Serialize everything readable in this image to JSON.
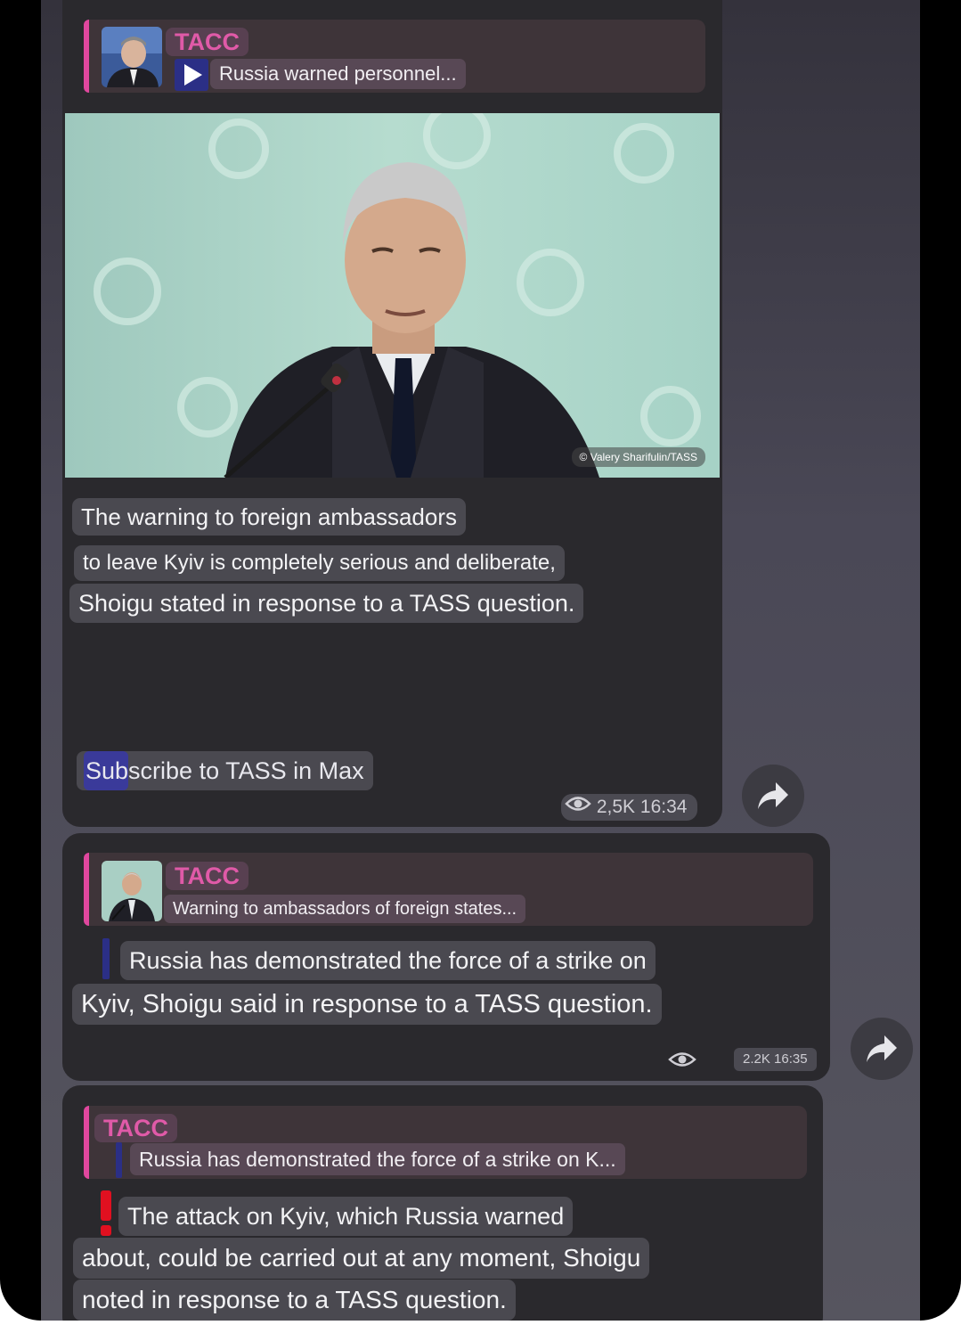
{
  "messages": [
    {
      "reply": {
        "name": "TACC",
        "text": "Russia warned personnel..."
      },
      "photo_credit": "© Valery Sharifulin/TASS",
      "lines": [
        "The warning to foreign ambassadors",
        "to leave Kyiv is completely serious and deliberate,",
        "Shoigu stated in response to a TASS question."
      ],
      "subscribe": "Subscribe to TASS in Max",
      "views": "2,5K",
      "time": "16:34"
    },
    {
      "reply": {
        "name": "TACC",
        "text": "Warning to ambassadors of foreign states..."
      },
      "lines": [
        "Russia has demonstrated the force of a strike on",
        "Kyiv, Shoigu said in response to a TASS question."
      ],
      "meta": "2.2K 16:35"
    },
    {
      "reply": {
        "name": "TACC",
        "text": "Russia has demonstrated the force of a strike on K..."
      },
      "lines": [
        "The attack on Kyiv, which Russia warned",
        "about, could be carried out at any moment, Shoigu",
        "noted in response to a TASS question."
      ]
    }
  ],
  "icons": {
    "play": "play-icon",
    "eye": "eye-icon",
    "forward": "forward-arrow-icon"
  },
  "colors": {
    "accent": "#e0479e",
    "reply_name": "#e05aa8",
    "bubble": "#2a292d"
  }
}
